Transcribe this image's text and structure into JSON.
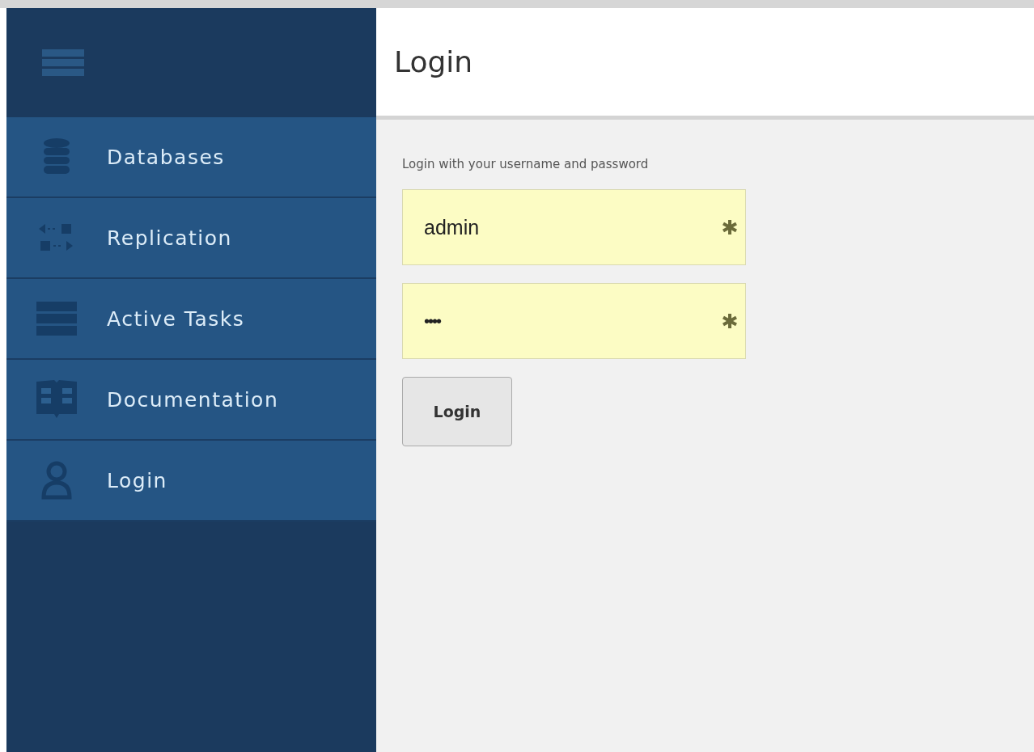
{
  "sidebar": {
    "items": [
      {
        "kind": "database",
        "label": "Databases"
      },
      {
        "kind": "replication",
        "label": "Replication"
      },
      {
        "kind": "tasks",
        "label": "Active Tasks"
      },
      {
        "kind": "docs",
        "label": "Documentation"
      },
      {
        "kind": "user",
        "label": "Login"
      }
    ]
  },
  "header": {
    "title": "Login"
  },
  "form": {
    "hint": "Login with your username and password",
    "fields": [
      {
        "kind": "text",
        "value": "admin",
        "required": true
      },
      {
        "kind": "password",
        "value": "••••",
        "required": true
      }
    ],
    "button": "Login"
  }
}
